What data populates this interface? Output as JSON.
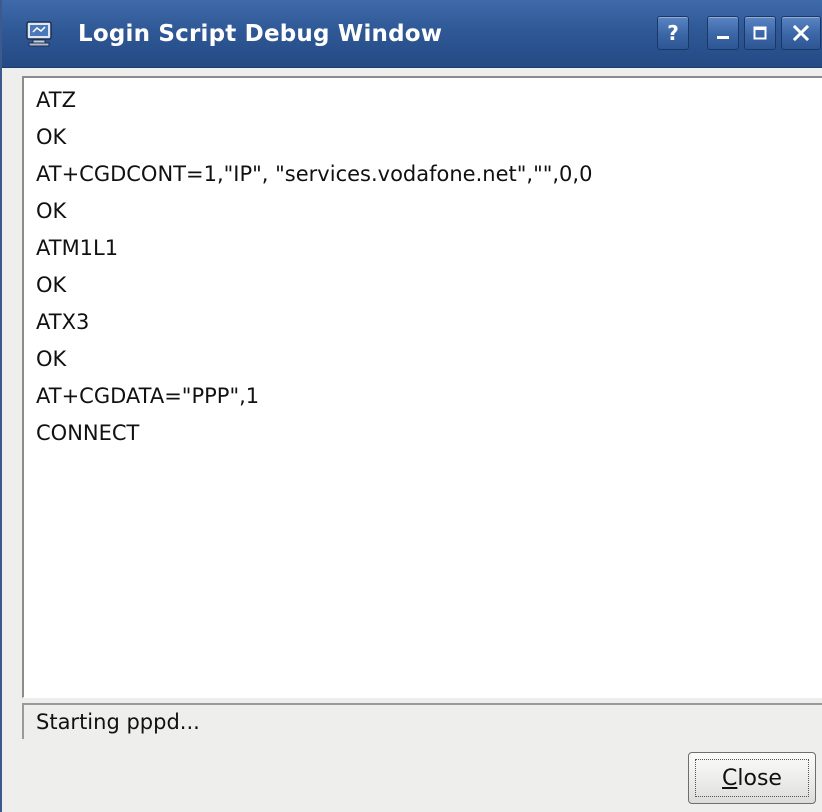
{
  "window": {
    "title": "Login Script Debug Window"
  },
  "titlebar_buttons": {
    "help": "?"
  },
  "log": {
    "lines": [
      "ATZ",
      "OK",
      "AT+CGDCONT=1,\"IP\", \"services.vodafone.net\",\"\",0,0",
      "OK",
      "ATM1L1",
      "OK",
      "ATX3",
      "OK",
      "AT+CGDATA=\"PPP\",1",
      "CONNECT"
    ]
  },
  "status": {
    "text": "Starting pppd..."
  },
  "buttons": {
    "close_mnemonic": "C",
    "close_rest": "lose"
  },
  "colors": {
    "titlebar": "#2f5896",
    "window_bg": "#eeeeec",
    "content_bg": "#ffffff"
  }
}
